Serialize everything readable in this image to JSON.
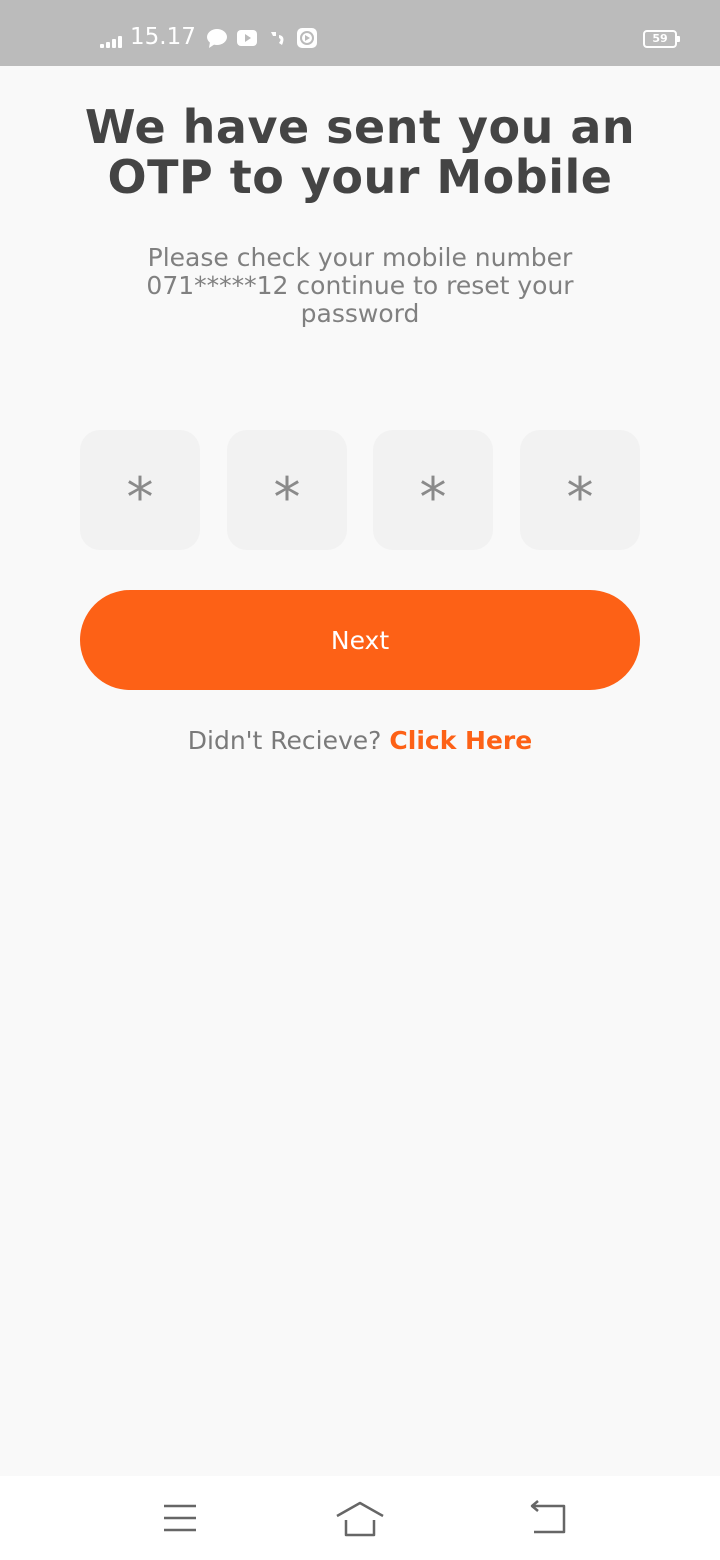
{
  "status_bar": {
    "time": "15.17",
    "battery": "59",
    "notification_icons": [
      "chat-bubble-icon",
      "youtube-icon",
      "app-icon",
      "play-store-icon"
    ]
  },
  "main": {
    "title": "We have sent you an OTP to your Mobile",
    "subtitle": "Please check your mobile number 071*****12 continue to reset your password",
    "otp_digits": [
      "*",
      "*",
      "*",
      "*"
    ],
    "next_label": "Next",
    "resend_prompt": "Didn't Recieve?",
    "resend_link": "Click Here"
  },
  "colors": {
    "accent": "#fd6116",
    "background": "#f9f9f9",
    "otp_box": "#f2f2f2",
    "status_bar": "#bbbbbb"
  },
  "nav_bar": {
    "icons": [
      "menu-icon",
      "home-icon",
      "back-icon"
    ]
  }
}
